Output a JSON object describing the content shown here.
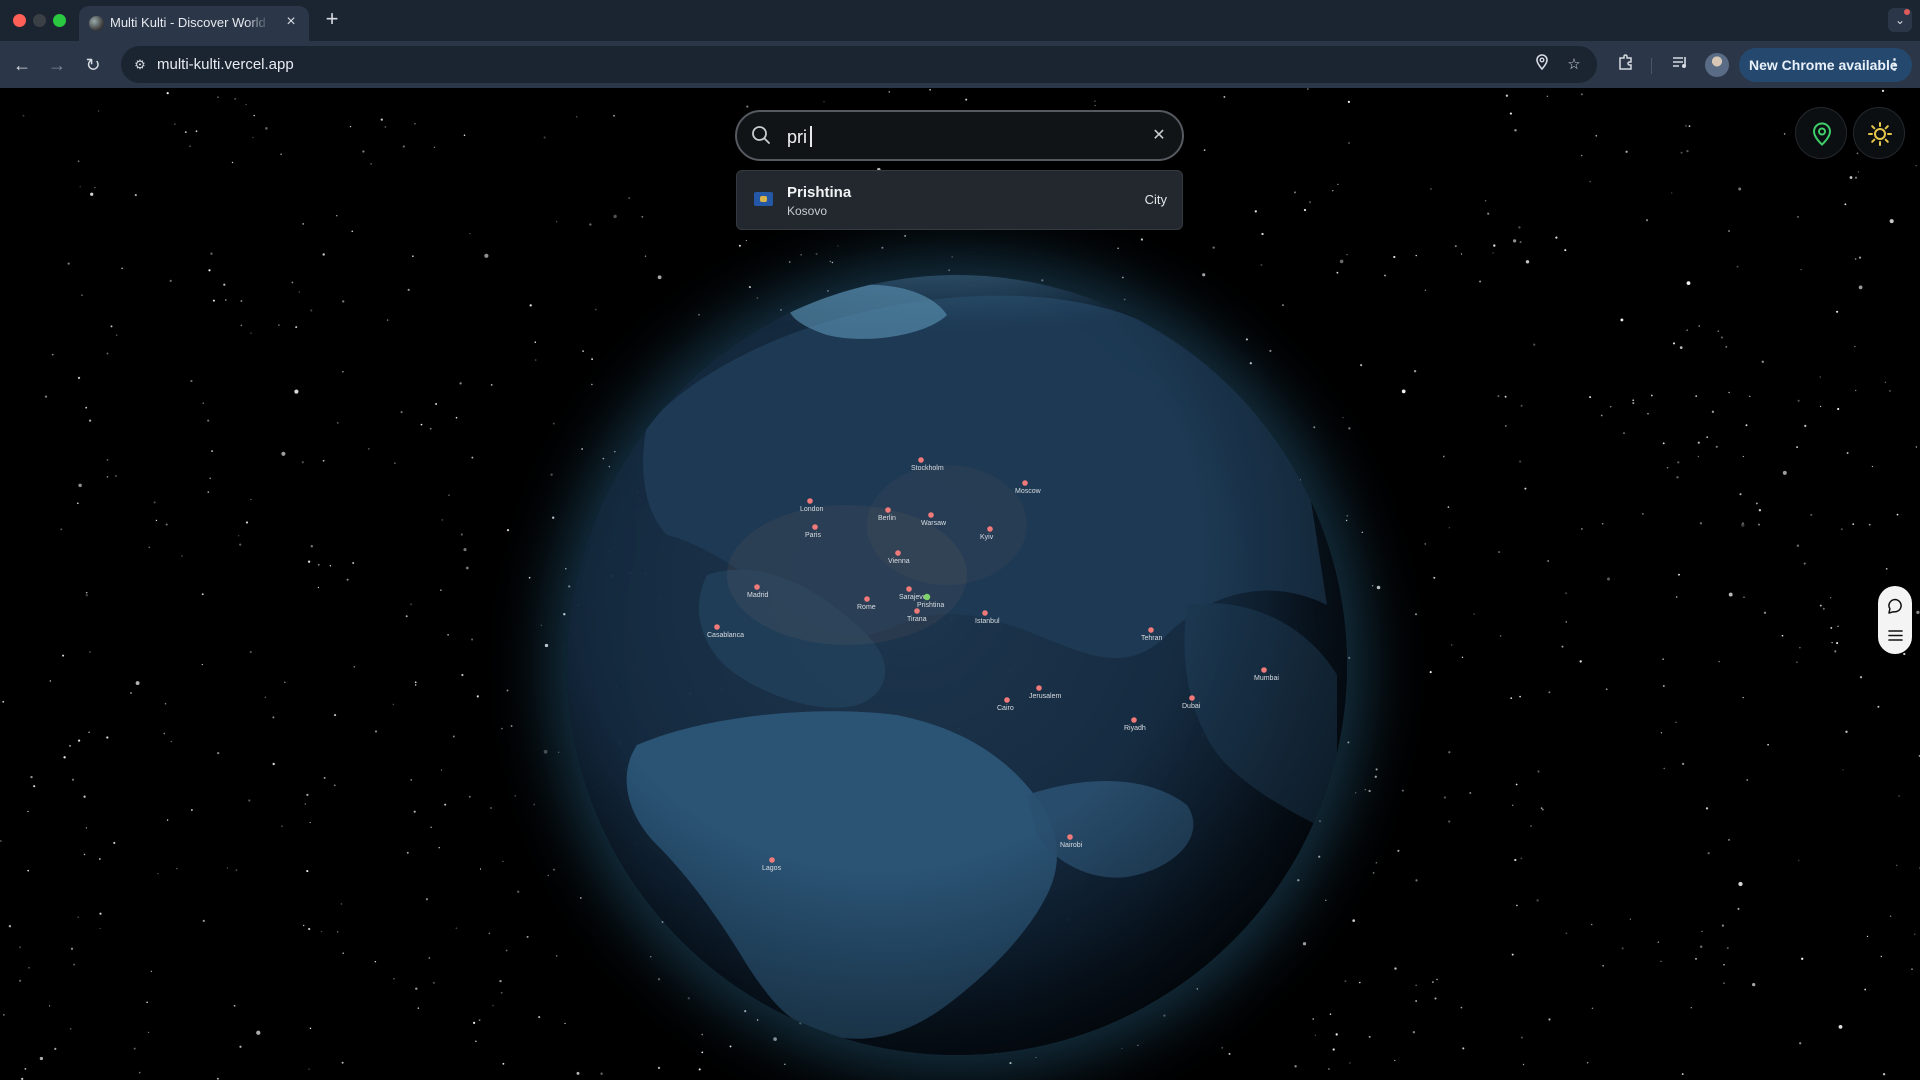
{
  "browser": {
    "tab_title": "Multi Kulti - Discover World Cultures",
    "tab_close": "×",
    "new_tab": "+",
    "url": "multi-kulti.vercel.app",
    "update_button": "New Chrome available",
    "update_menu": "⋮"
  },
  "search": {
    "value": "pri",
    "clear": "✕"
  },
  "suggestions": [
    {
      "title": "Prishtina",
      "subtitle": "Kosovo",
      "type": "City",
      "flag": "kosovo-flag"
    }
  ],
  "globe": {
    "cities": [
      "Stockholm",
      "Moscow",
      "London",
      "Berlin",
      "Warsaw",
      "Kyiv",
      "Paris",
      "Vienna",
      "Madrid",
      "Sarajevo",
      "Prishtina",
      "Rome",
      "Tirana",
      "Istanbul",
      "Casablanca",
      "Tehran",
      "Jerusalem",
      "Cairo",
      "Riyadh",
      "Dubai",
      "Nairobi",
      "Mumbai",
      "Lagos"
    ],
    "highlighted_city": "Prishtina",
    "marker_color": "#f07a7a",
    "highlight_color": "#7ed36a"
  },
  "icons": {
    "location": "location-pin-icon",
    "theme": "sun-icon",
    "chat": "chat-bubble-icon",
    "menu": "hamburger-menu-icon"
  },
  "colors": {
    "accent_green": "#3ecf6a",
    "accent_yellow": "#e6c84a",
    "chrome_bg": "#1b2431",
    "update_pill": "#25496e"
  }
}
